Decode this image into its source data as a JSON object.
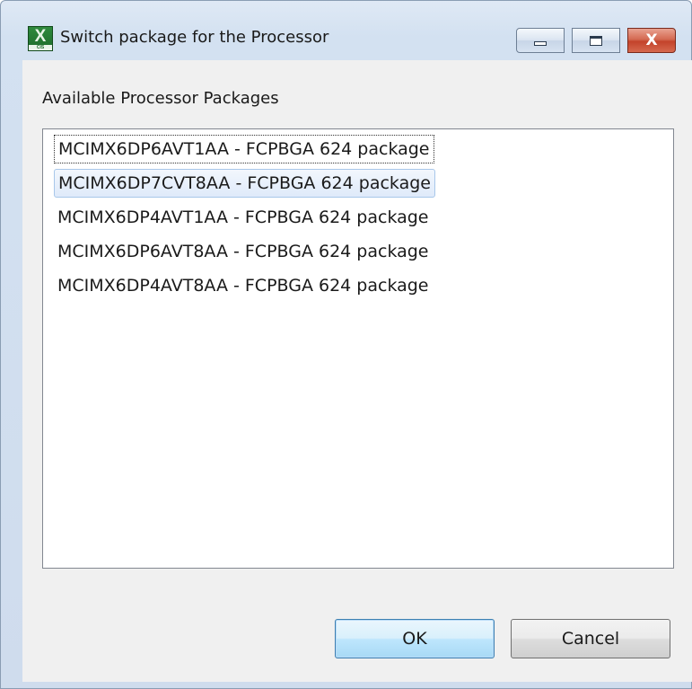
{
  "window": {
    "title": "Switch package for the Processor",
    "icon_letter": "X",
    "icon_sub": "CIS"
  },
  "caption_buttons": {
    "close_glyph": "X"
  },
  "dialog": {
    "group_label": "Available Processor Packages",
    "packages": [
      {
        "label": "MCIMX6DP6AVT1AA - FCPBGA 624 package"
      },
      {
        "label": "MCIMX6DP7CVT8AA - FCPBGA 624 package"
      },
      {
        "label": "MCIMX6DP4AVT1AA - FCPBGA 624 package"
      },
      {
        "label": "MCIMX6DP6AVT8AA - FCPBGA 624 package"
      },
      {
        "label": "MCIMX6DP4AVT8AA - FCPBGA 624 package"
      }
    ],
    "ok_label": "OK",
    "cancel_label": "Cancel"
  },
  "colors": {
    "accent": "#3c7fb1",
    "selection_fill": "#dfeafa",
    "close_red": "#c3432b"
  }
}
